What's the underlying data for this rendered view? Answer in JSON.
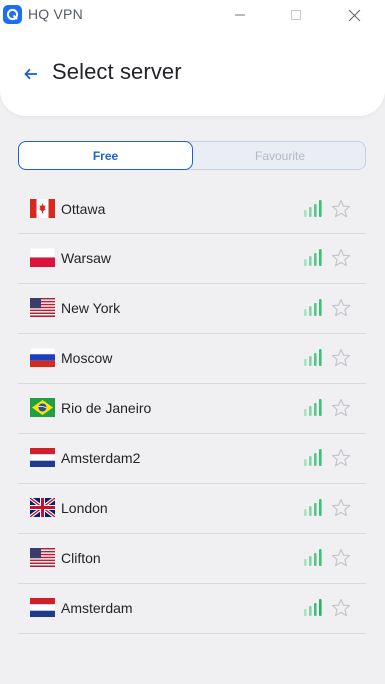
{
  "app": {
    "title": "HQ VPN",
    "logo_icon": "hq-vpn-logo-icon",
    "accent_color": "#1e6df2"
  },
  "window_controls": [
    "minimize-icon",
    "maximize-icon",
    "close-icon"
  ],
  "header": {
    "back_icon": "arrow-left-icon",
    "title": "Select server"
  },
  "tabs": [
    {
      "label": "Free",
      "selected": true
    },
    {
      "label": "Favourite",
      "selected": false
    }
  ],
  "servers": [
    {
      "name": "Ottawa",
      "flag": "canada-flag",
      "signal_bars": 4,
      "favourite": false
    },
    {
      "name": "Warsaw",
      "flag": "poland-flag",
      "signal_bars": 4,
      "favourite": false
    },
    {
      "name": "New York",
      "flag": "usa-flag",
      "signal_bars": 4,
      "favourite": false
    },
    {
      "name": "Moscow",
      "flag": "russia-flag",
      "signal_bars": 4,
      "favourite": false
    },
    {
      "name": "Rio de Janeiro",
      "flag": "brazil-flag",
      "signal_bars": 4,
      "favourite": false
    },
    {
      "name": "Amsterdam2",
      "flag": "netherlands-flag",
      "signal_bars": 4,
      "favourite": false
    },
    {
      "name": "London",
      "flag": "uk-flag",
      "signal_bars": 4,
      "favourite": false
    },
    {
      "name": "Clifton",
      "flag": "usa-flag",
      "signal_bars": 4,
      "favourite": false
    },
    {
      "name": "Amsterdam",
      "flag": "netherlands-flag",
      "signal_bars": 4,
      "favourite": false
    }
  ],
  "colors": {
    "signal_green": "#3cbf7a",
    "signal_light": "#a6e3c2",
    "star_outline": "#c4c6cc",
    "selected_tab": "#1e5fd8"
  }
}
